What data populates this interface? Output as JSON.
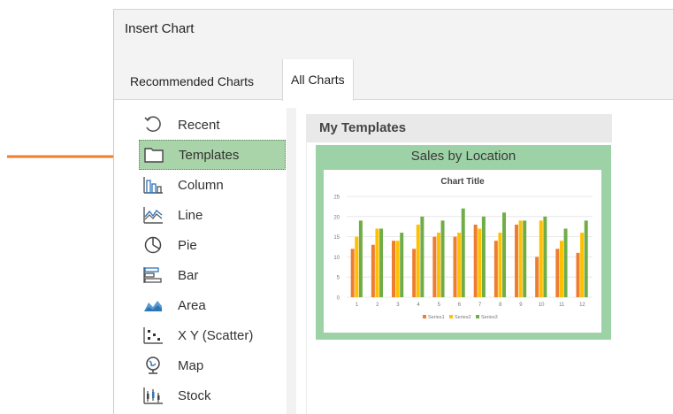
{
  "window": {
    "title": "Insert Chart"
  },
  "tabs": [
    {
      "label": "Recommended Charts",
      "active": false
    },
    {
      "label": "All Charts",
      "active": true
    }
  ],
  "categories": [
    {
      "label": "Recent",
      "icon": "recent-icon",
      "selected": false
    },
    {
      "label": "Templates",
      "icon": "folder-icon",
      "selected": true
    },
    {
      "label": "Column",
      "icon": "column-chart-icon",
      "selected": false
    },
    {
      "label": "Line",
      "icon": "line-chart-icon",
      "selected": false
    },
    {
      "label": "Pie",
      "icon": "pie-chart-icon",
      "selected": false
    },
    {
      "label": "Bar",
      "icon": "bar-chart-icon",
      "selected": false
    },
    {
      "label": "Area",
      "icon": "area-chart-icon",
      "selected": false
    },
    {
      "label": "X Y (Scatter)",
      "icon": "scatter-chart-icon",
      "selected": false
    },
    {
      "label": "Map",
      "icon": "map-chart-icon",
      "selected": false
    },
    {
      "label": "Stock",
      "icon": "stock-chart-icon",
      "selected": false
    }
  ],
  "templates_panel": {
    "header": "My Templates",
    "template_name": "Sales by Location"
  },
  "colors": {
    "accent_arrow": "#ed7d31",
    "selected_bg": "#a9d3a9",
    "template_card": "#9dd2a6",
    "series1": "#ed7d31",
    "series2": "#ffc000",
    "series3": "#70ad47"
  },
  "chart_data": {
    "type": "bar",
    "title": "Chart Title",
    "categories": [
      "1",
      "2",
      "3",
      "4",
      "5",
      "6",
      "7",
      "8",
      "9",
      "10",
      "11",
      "12"
    ],
    "series": [
      {
        "name": "Series1",
        "values": [
          12,
          13,
          14,
          12,
          15,
          15,
          18,
          14,
          18,
          10,
          12,
          11
        ]
      },
      {
        "name": "Series2",
        "values": [
          15,
          17,
          14,
          18,
          16,
          16,
          17,
          16,
          19,
          19,
          14,
          16
        ]
      },
      {
        "name": "Series3",
        "values": [
          19,
          17,
          16,
          20,
          19,
          22,
          20,
          21,
          19,
          20,
          17,
          19
        ]
      }
    ],
    "ylim": [
      0,
      25
    ],
    "yticks": [
      0,
      5,
      10,
      15,
      20,
      25
    ],
    "grid": true,
    "legend": "bottom"
  }
}
